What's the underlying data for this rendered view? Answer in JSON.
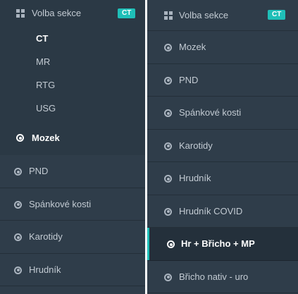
{
  "left": {
    "header": {
      "title": "Volba sekce",
      "badge": "CT"
    },
    "submenu": [
      "CT",
      "MR",
      "RTG",
      "USG"
    ],
    "items": [
      "Mozek",
      "PND",
      "Spánkové kosti",
      "Karotidy",
      "Hrudník"
    ]
  },
  "right": {
    "header": {
      "title": "Volba sekce",
      "badge": "CT"
    },
    "items": [
      "Mozek",
      "PND",
      "Spánkové kosti",
      "Karotidy",
      "Hrudník",
      "Hrudník COVID",
      "Hr + Břicho + MP",
      "Břicho nativ - uro"
    ]
  },
  "colors": {
    "accent": "#1fbfb8",
    "sidebar_bg": "#2f3d4a",
    "sidebar_dark": "#2b3945"
  },
  "icons": {
    "section": "grid-icon",
    "item": "radio-icon"
  }
}
